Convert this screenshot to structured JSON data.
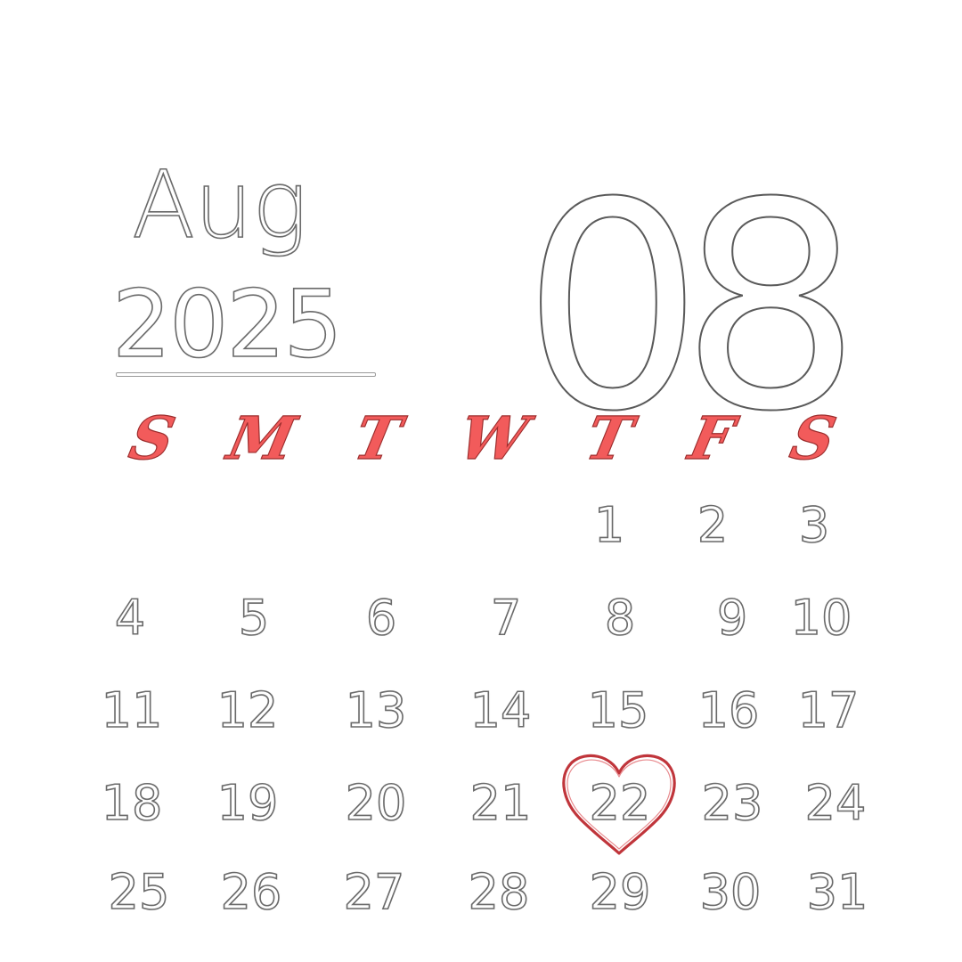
{
  "header": {
    "month": "Aug",
    "year": "2025",
    "month_number": "08"
  },
  "weekdays": [
    "S",
    "M",
    "T",
    "W",
    "T",
    "F",
    "S"
  ],
  "calendar": {
    "weeks": [
      [
        "",
        "",
        "",
        "",
        "1",
        "2",
        "3"
      ],
      [
        "4",
        "5",
        "6",
        "7",
        "8",
        "9",
        "10"
      ],
      [
        "11",
        "12",
        "13",
        "14",
        "15",
        "16",
        "17"
      ],
      [
        "18",
        "19",
        "20",
        "21",
        "22",
        "23",
        "24"
      ],
      [
        "25",
        "26",
        "27",
        "28",
        "29",
        "30",
        "31"
      ]
    ],
    "highlighted_day": "22",
    "highlight_icon": "heart-icon"
  },
  "colors": {
    "background": "#ffffff",
    "weekday_accent": "#f25b5b",
    "heart_stroke": "#c0353b",
    "outline": "#6a6a6a"
  }
}
